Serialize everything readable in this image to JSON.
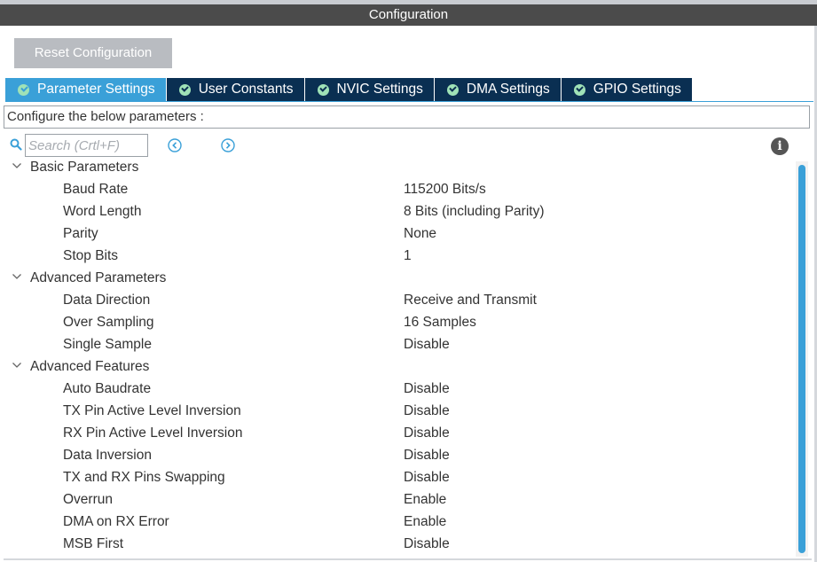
{
  "window": {
    "title": "Configuration"
  },
  "toolbar": {
    "reset_label": "Reset Configuration"
  },
  "tabs": [
    {
      "label": "Parameter Settings",
      "active": true
    },
    {
      "label": "User Constants",
      "active": false
    },
    {
      "label": "NVIC Settings",
      "active": false
    },
    {
      "label": "DMA Settings",
      "active": false
    },
    {
      "label": "GPIO Settings",
      "active": false
    }
  ],
  "description": "Configure the below parameters :",
  "search": {
    "placeholder": "Search (Crtl+F)"
  },
  "groups": [
    {
      "label": "Basic Parameters",
      "params": [
        {
          "name": "Baud Rate",
          "value": "115200 Bits/s"
        },
        {
          "name": "Word Length",
          "value": "8 Bits (including Parity)"
        },
        {
          "name": "Parity",
          "value": "None"
        },
        {
          "name": "Stop Bits",
          "value": "1"
        }
      ]
    },
    {
      "label": "Advanced Parameters",
      "params": [
        {
          "name": "Data Direction",
          "value": "Receive and Transmit"
        },
        {
          "name": "Over Sampling",
          "value": "16 Samples"
        },
        {
          "name": "Single Sample",
          "value": "Disable"
        }
      ]
    },
    {
      "label": "Advanced Features",
      "params": [
        {
          "name": "Auto Baudrate",
          "value": "Disable"
        },
        {
          "name": "TX Pin Active Level Inversion",
          "value": "Disable"
        },
        {
          "name": "RX Pin Active Level Inversion",
          "value": "Disable"
        },
        {
          "name": "Data Inversion",
          "value": "Disable"
        },
        {
          "name": "TX and RX Pins Swapping",
          "value": "Disable"
        },
        {
          "name": "Overrun",
          "value": "Enable"
        },
        {
          "name": "DMA on RX Error",
          "value": "Enable"
        },
        {
          "name": "MSB First",
          "value": "Disable"
        }
      ]
    }
  ],
  "icons": {
    "tab_check": "check-circle-icon",
    "search": "search-icon",
    "prev": "chevron-left-circle-icon",
    "next": "chevron-right-circle-icon",
    "info": "info-icon",
    "group_toggle": "chevron-down-icon"
  },
  "colors": {
    "title_bar": "#4b4b4b",
    "tab_active": "#3aa0d8",
    "tab_inactive": "#0a2f52",
    "check": "#9fe2b7",
    "button": "#b9bcc1",
    "scrollbar": "#3aa0d8"
  }
}
